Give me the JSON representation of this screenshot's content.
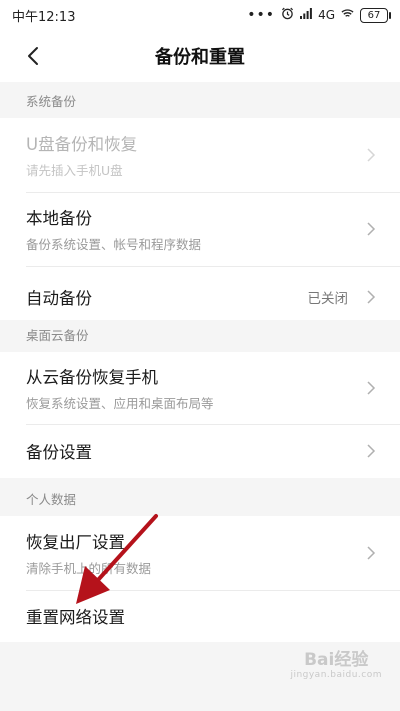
{
  "status_bar": {
    "time": "中午12:13",
    "signal_dots": "•••",
    "network": "4G",
    "battery": "67"
  },
  "header": {
    "title": "备份和重置"
  },
  "sections": [
    {
      "label": "系统备份",
      "items": [
        {
          "title": "U盘备份和恢复",
          "subtitle": "请先插入手机U盘",
          "enabled": false
        },
        {
          "title": "本地备份",
          "subtitle": "备份系统设置、帐号和程序数据"
        },
        {
          "title": "自动备份",
          "value": "已关闭"
        }
      ]
    },
    {
      "label": "桌面云备份",
      "items": [
        {
          "title": "从云备份恢复手机",
          "subtitle": "恢复系统设置、应用和桌面布局等"
        },
        {
          "title": "备份设置"
        }
      ]
    },
    {
      "label": "个人数据",
      "items": [
        {
          "title": "恢复出厂设置",
          "subtitle": "清除手机上的所有数据"
        },
        {
          "title": "重置网络设置"
        }
      ]
    }
  ],
  "watermark": {
    "main": "Bai经验",
    "sub": "jingyan.baidu.com"
  },
  "colors": {
    "annotation_arrow": "#b5121b"
  }
}
